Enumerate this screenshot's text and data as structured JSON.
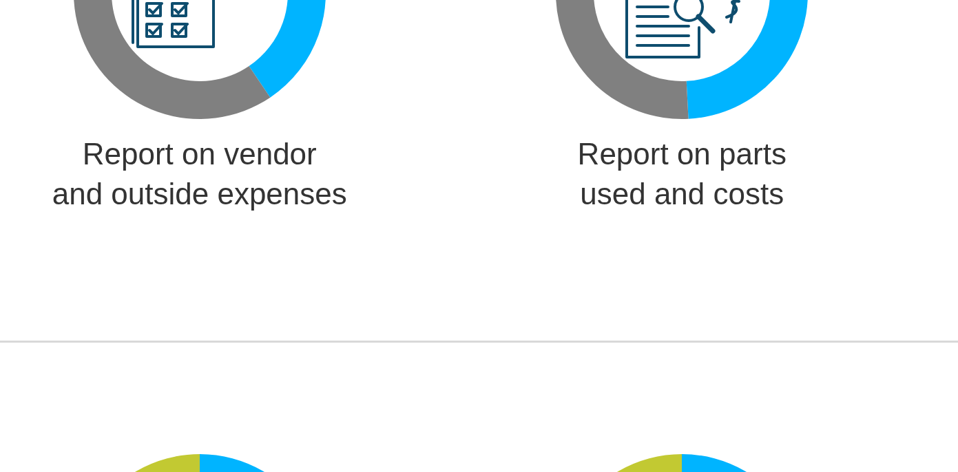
{
  "reports": [
    {
      "kind": "checklist",
      "caption_lines": [
        "Report on vendor",
        "and outside expenses"
      ]
    },
    {
      "kind": "invoice",
      "caption_lines": [
        "Report on parts",
        "used and costs"
      ]
    }
  ]
}
